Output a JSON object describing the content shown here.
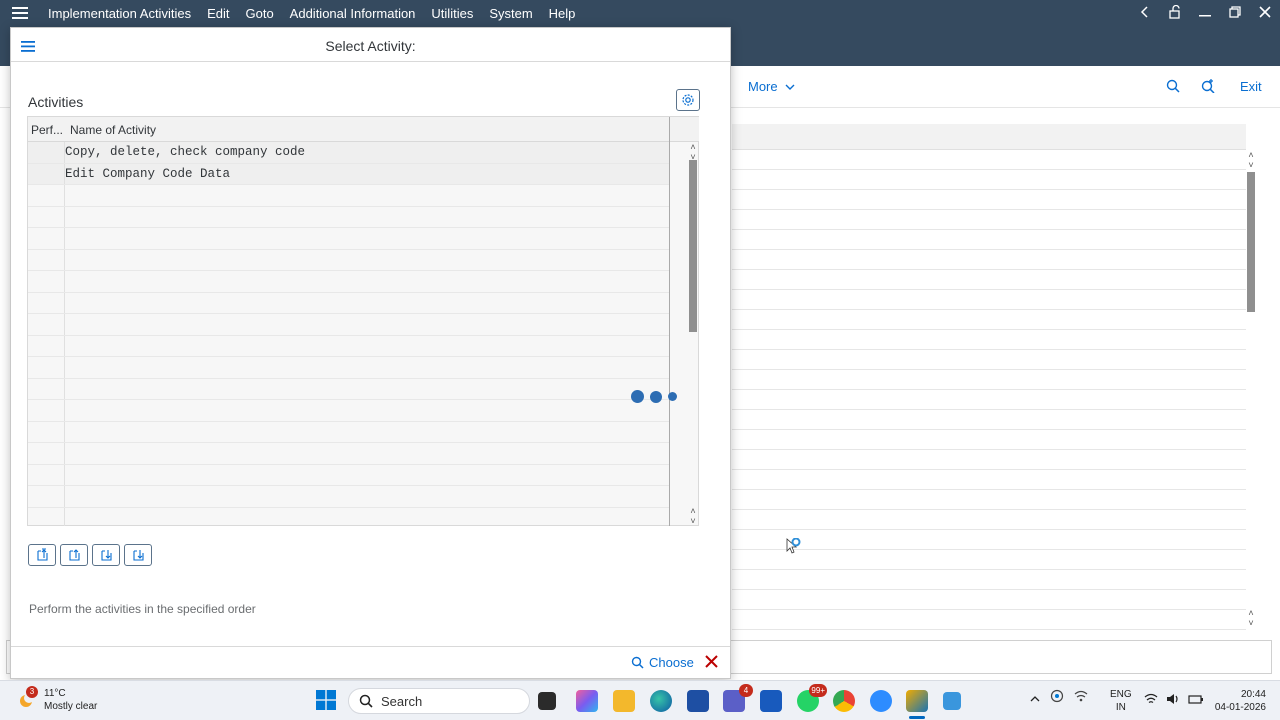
{
  "menubar": {
    "items": [
      "Implementation Activities",
      "Edit",
      "Goto",
      "Additional Information",
      "Utilities",
      "System",
      "Help"
    ]
  },
  "background": {
    "toolbar": {
      "more_label": "More",
      "exit_label": "Exit"
    }
  },
  "dialog": {
    "title": "Select Activity:",
    "section_title": "Activities",
    "table": {
      "columns": [
        "Perf...",
        "Name of Activity"
      ],
      "rows": [
        {
          "perf": "",
          "name": "Copy, delete, check company code"
        },
        {
          "perf": "",
          "name": "Edit Company Code Data"
        }
      ]
    },
    "hint": "Perform the activities in the specified order",
    "footer": {
      "choose_label": "Choose"
    }
  },
  "taskbar": {
    "weather": {
      "temp": "11°C",
      "desc": "Mostly clear",
      "badge": "3"
    },
    "search_placeholder": "Search",
    "teams_badge": "4",
    "whatsapp_badge": "99+",
    "lang": {
      "line1": "ENG",
      "line2": "IN"
    },
    "clock": {
      "time": "20:44",
      "date": "04-01-2026"
    }
  },
  "colors": {
    "shell": "#354a5f",
    "link": "#0a6ed1",
    "cancel": "#bb0000",
    "loader": "#2d6db3"
  }
}
